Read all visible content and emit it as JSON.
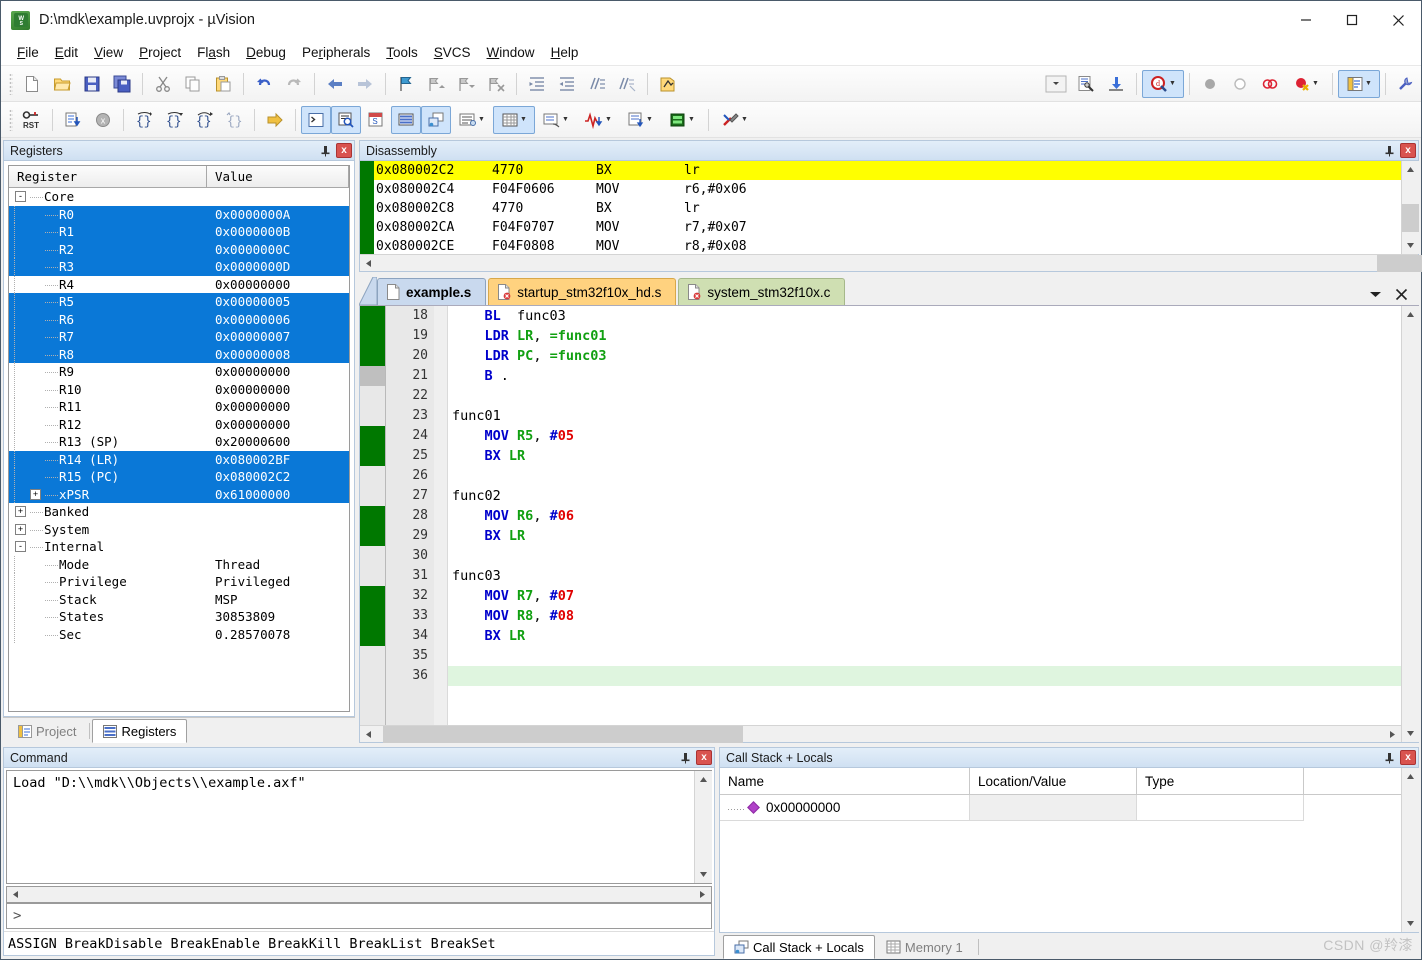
{
  "window": {
    "title": "D:\\mdk\\example.uvprojx - µVision",
    "app_icon": "uvision-icon",
    "minimize": "—",
    "maximize": "□",
    "close": "✕"
  },
  "menubar": {
    "items": [
      {
        "label": "File",
        "accel": "F"
      },
      {
        "label": "Edit",
        "accel": "E"
      },
      {
        "label": "View",
        "accel": "V"
      },
      {
        "label": "Project",
        "accel": "P"
      },
      {
        "label": "Flash",
        "accel": "a"
      },
      {
        "label": "Debug",
        "accel": "D"
      },
      {
        "label": "Peripherals",
        "accel": "r"
      },
      {
        "label": "Tools",
        "accel": "T"
      },
      {
        "label": "SVCS",
        "accel": "S"
      },
      {
        "label": "Window",
        "accel": "W"
      },
      {
        "label": "Help",
        "accel": "H"
      }
    ]
  },
  "toolbar_main": {
    "buttons": [
      {
        "name": "new-file-icon",
        "tip": "New"
      },
      {
        "name": "open-file-icon",
        "tip": "Open"
      },
      {
        "name": "save-icon",
        "tip": "Save"
      },
      {
        "name": "save-all-icon",
        "tip": "Save All"
      },
      {
        "name": "cut-icon",
        "tip": "Cut"
      },
      {
        "name": "copy-icon",
        "tip": "Copy"
      },
      {
        "name": "paste-icon",
        "tip": "Paste"
      },
      {
        "name": "undo-icon",
        "tip": "Undo"
      },
      {
        "name": "redo-icon",
        "tip": "Redo"
      },
      {
        "name": "navigate-back-icon",
        "tip": "Back"
      },
      {
        "name": "navigate-forward-icon",
        "tip": "Forward"
      },
      {
        "name": "bookmark-toggle-icon",
        "tip": "Insert/Remove Bookmark"
      },
      {
        "name": "bookmark-prev-icon",
        "tip": "Previous Bookmark"
      },
      {
        "name": "bookmark-next-icon",
        "tip": "Next Bookmark"
      },
      {
        "name": "bookmark-clear-icon",
        "tip": "Clear All Bookmarks"
      },
      {
        "name": "indent-icon",
        "tip": "Indent"
      },
      {
        "name": "outdent-icon",
        "tip": "Outdent"
      },
      {
        "name": "comment-icon",
        "tip": "Comment"
      },
      {
        "name": "uncomment-icon",
        "tip": "Uncomment"
      },
      {
        "name": "build-icon",
        "tip": "Build"
      }
    ],
    "right_buttons": [
      {
        "name": "combo-dropdown-icon",
        "tip": "Target selector"
      },
      {
        "name": "configure-target-icon",
        "tip": "Options for Target"
      },
      {
        "name": "download-icon",
        "tip": "Download"
      },
      {
        "name": "start-stop-debug-icon",
        "tip": "Start/Stop Debug Session",
        "active": true
      },
      {
        "name": "breakpoint-disabled-icon",
        "tip": "Insert/Remove Breakpoint"
      },
      {
        "name": "breakpoint-enable-icon",
        "tip": "Enable/Disable Breakpoint"
      },
      {
        "name": "breakpoint-disable-all-icon",
        "tip": "Disable All Breakpoints"
      },
      {
        "name": "breakpoint-kill-all-icon",
        "tip": "Kill All Breakpoints"
      },
      {
        "name": "project-window-icon",
        "tip": "Project Window",
        "active": true
      },
      {
        "name": "configure-icon",
        "tip": "Configure"
      }
    ]
  },
  "toolbar_debug": {
    "buttons": [
      {
        "name": "reset-cpu-icon",
        "tip": "Reset CPU"
      },
      {
        "name": "run-icon",
        "tip": "Run"
      },
      {
        "name": "stop-icon",
        "tip": "Stop"
      },
      {
        "name": "step-into-icon",
        "tip": "Step"
      },
      {
        "name": "step-over-icon",
        "tip": "Step Over"
      },
      {
        "name": "step-out-icon",
        "tip": "Step Out"
      },
      {
        "name": "run-to-cursor-icon",
        "tip": "Run to Cursor Line"
      },
      {
        "name": "show-next-statement-icon",
        "tip": "Show Next Statement"
      },
      {
        "name": "command-window-icon",
        "tip": "Command Window",
        "active": true
      },
      {
        "name": "disassembly-window-icon",
        "tip": "Disassembly Window",
        "active": true
      },
      {
        "name": "symbols-window-icon",
        "tip": "Symbols Window"
      },
      {
        "name": "registers-window-icon",
        "tip": "Registers Window",
        "active": true
      },
      {
        "name": "call-stack-window-icon",
        "tip": "Call Stack Window",
        "active": true
      },
      {
        "name": "watch-windows-icon",
        "tip": "Watch Windows"
      },
      {
        "name": "memory-windows-icon",
        "tip": "Memory Windows",
        "active": true
      },
      {
        "name": "serial-windows-icon",
        "tip": "Serial Windows"
      },
      {
        "name": "analysis-windows-icon",
        "tip": "Analysis Windows"
      },
      {
        "name": "trace-windows-icon",
        "tip": "Trace Windows"
      },
      {
        "name": "system-viewer-icon",
        "tip": "System Viewer"
      },
      {
        "name": "toolbox-icon",
        "tip": "Toolbox"
      }
    ]
  },
  "registers_panel": {
    "title": "Registers",
    "pin_icon": "pin-icon",
    "close_icon": "close-icon",
    "columns": [
      "Register",
      "Value"
    ],
    "rows": [
      {
        "label": "Core",
        "value": "",
        "depth": 0,
        "expander": "-",
        "selected": false
      },
      {
        "label": "R0",
        "value": "0x0000000A",
        "depth": 2,
        "expander": "",
        "selected": true
      },
      {
        "label": "R1",
        "value": "0x0000000B",
        "depth": 2,
        "expander": "",
        "selected": true
      },
      {
        "label": "R2",
        "value": "0x0000000C",
        "depth": 2,
        "expander": "",
        "selected": true
      },
      {
        "label": "R3",
        "value": "0x0000000D",
        "depth": 2,
        "expander": "",
        "selected": true
      },
      {
        "label": "R4",
        "value": "0x00000000",
        "depth": 2,
        "expander": "",
        "selected": false
      },
      {
        "label": "R5",
        "value": "0x00000005",
        "depth": 2,
        "expander": "",
        "selected": true
      },
      {
        "label": "R6",
        "value": "0x00000006",
        "depth": 2,
        "expander": "",
        "selected": true
      },
      {
        "label": "R7",
        "value": "0x00000007",
        "depth": 2,
        "expander": "",
        "selected": true
      },
      {
        "label": "R8",
        "value": "0x00000008",
        "depth": 2,
        "expander": "",
        "selected": true
      },
      {
        "label": "R9",
        "value": "0x00000000",
        "depth": 2,
        "expander": "",
        "selected": false
      },
      {
        "label": "R10",
        "value": "0x00000000",
        "depth": 2,
        "expander": "",
        "selected": false
      },
      {
        "label": "R11",
        "value": "0x00000000",
        "depth": 2,
        "expander": "",
        "selected": false
      },
      {
        "label": "R12",
        "value": "0x00000000",
        "depth": 2,
        "expander": "",
        "selected": false
      },
      {
        "label": "R13 (SP)",
        "value": "0x20000600",
        "depth": 2,
        "expander": "",
        "selected": false
      },
      {
        "label": "R14 (LR)",
        "value": "0x080002BF",
        "depth": 2,
        "expander": "",
        "selected": true
      },
      {
        "label": "R15 (PC)",
        "value": "0x080002C2",
        "depth": 2,
        "expander": "",
        "selected": true
      },
      {
        "label": "xPSR",
        "value": "0x61000000",
        "depth": 1,
        "expander": "+",
        "selected": true
      },
      {
        "label": "Banked",
        "value": "",
        "depth": 0,
        "expander": "+",
        "selected": false
      },
      {
        "label": "System",
        "value": "",
        "depth": 0,
        "expander": "+",
        "selected": false
      },
      {
        "label": "Internal",
        "value": "",
        "depth": 0,
        "expander": "-",
        "selected": false
      },
      {
        "label": "Mode",
        "value": "Thread",
        "depth": 2,
        "expander": "",
        "selected": false
      },
      {
        "label": "Privilege",
        "value": "Privileged",
        "depth": 2,
        "expander": "",
        "selected": false
      },
      {
        "label": "Stack",
        "value": "MSP",
        "depth": 2,
        "expander": "",
        "selected": false
      },
      {
        "label": "States",
        "value": "30853809",
        "depth": 2,
        "expander": "",
        "selected": false
      },
      {
        "label": "Sec",
        "value": "0.28570078",
        "depth": 2,
        "expander": "",
        "selected": false
      }
    ]
  },
  "left_dock_tabs": [
    {
      "label": "Project",
      "icon": "project-icon",
      "active": false
    },
    {
      "label": "Registers",
      "icon": "registers-icon",
      "active": true
    }
  ],
  "disassembly": {
    "title": "Disassembly",
    "pin_icon": "pin-icon",
    "close_icon": "close-icon",
    "current_marker": "yellow-arrow-icon",
    "lines": [
      {
        "address": "0x080002C2",
        "opcode": "4770",
        "mnemonic": "BX",
        "operands": "lr",
        "current": true
      },
      {
        "address": "0x080002C4",
        "opcode": "F04F0606",
        "mnemonic": "MOV",
        "operands": "r6,#0x06",
        "current": false
      },
      {
        "address": "0x080002C8",
        "opcode": "4770",
        "mnemonic": "BX",
        "operands": "lr",
        "current": false
      },
      {
        "address": "0x080002CA",
        "opcode": "F04F0707",
        "mnemonic": "MOV",
        "operands": "r7,#0x07",
        "current": false
      },
      {
        "address": "0x080002CE",
        "opcode": "F04F0808",
        "mnemonic": "MOV",
        "operands": "r8,#0x08",
        "current": false
      }
    ]
  },
  "editor": {
    "tabs": [
      {
        "label": "example.s",
        "icon": "text-file-icon",
        "active": true,
        "style": "active"
      },
      {
        "label": "startup_stm32f10x_hd.s",
        "icon": "asm-file-icon",
        "active": false,
        "style": "orange"
      },
      {
        "label": "system_stm32f10x.c",
        "icon": "c-file-icon",
        "active": false,
        "style": "green"
      }
    ],
    "tab_dropdown_icon": "chevron-down-icon",
    "tab_close_icon": "close-icon",
    "lines": [
      {
        "no": "18",
        "marker": "green",
        "highlight": false,
        "tokens": [
          {
            "t": "plain",
            "v": "    "
          },
          {
            "t": "mn",
            "v": "BL"
          },
          {
            "t": "plain",
            "v": "  func03"
          }
        ]
      },
      {
        "no": "19",
        "marker": "green",
        "highlight": false,
        "tokens": [
          {
            "t": "plain",
            "v": "    "
          },
          {
            "t": "mn",
            "v": "LDR"
          },
          {
            "t": "plain",
            "v": " "
          },
          {
            "t": "reg",
            "v": "LR"
          },
          {
            "t": "plain",
            "v": ", "
          },
          {
            "t": "reg",
            "v": "=func01"
          }
        ]
      },
      {
        "no": "20",
        "marker": "green",
        "highlight": false,
        "tokens": [
          {
            "t": "plain",
            "v": "    "
          },
          {
            "t": "mn",
            "v": "LDR"
          },
          {
            "t": "plain",
            "v": " "
          },
          {
            "t": "reg",
            "v": "PC"
          },
          {
            "t": "plain",
            "v": ", "
          },
          {
            "t": "reg",
            "v": "=func03"
          }
        ]
      },
      {
        "no": "21",
        "marker": "gray",
        "highlight": false,
        "tokens": [
          {
            "t": "plain",
            "v": "    "
          },
          {
            "t": "mn",
            "v": "B"
          },
          {
            "t": "plain",
            "v": " ."
          }
        ]
      },
      {
        "no": "22",
        "marker": "none",
        "highlight": false,
        "tokens": []
      },
      {
        "no": "23",
        "marker": "none",
        "highlight": false,
        "tokens": [
          {
            "t": "plain",
            "v": "func01"
          }
        ]
      },
      {
        "no": "24",
        "marker": "green",
        "highlight": false,
        "tokens": [
          {
            "t": "plain",
            "v": "    "
          },
          {
            "t": "mn",
            "v": "MOV"
          },
          {
            "t": "plain",
            "v": " "
          },
          {
            "t": "reg",
            "v": "R5"
          },
          {
            "t": "plain",
            "v": ", "
          },
          {
            "t": "mn",
            "v": "#"
          },
          {
            "t": "num",
            "v": "05"
          }
        ]
      },
      {
        "no": "25",
        "marker": "green",
        "highlight": false,
        "tokens": [
          {
            "t": "plain",
            "v": "    "
          },
          {
            "t": "mn",
            "v": "BX"
          },
          {
            "t": "plain",
            "v": " "
          },
          {
            "t": "reg",
            "v": "LR"
          }
        ]
      },
      {
        "no": "26",
        "marker": "none",
        "highlight": false,
        "tokens": []
      },
      {
        "no": "27",
        "marker": "none",
        "highlight": false,
        "tokens": [
          {
            "t": "plain",
            "v": "func02"
          }
        ]
      },
      {
        "no": "28",
        "marker": "green",
        "highlight": false,
        "tokens": [
          {
            "t": "plain",
            "v": "    "
          },
          {
            "t": "mn",
            "v": "MOV"
          },
          {
            "t": "plain",
            "v": " "
          },
          {
            "t": "reg",
            "v": "R6"
          },
          {
            "t": "plain",
            "v": ", "
          },
          {
            "t": "mn",
            "v": "#"
          },
          {
            "t": "num",
            "v": "06"
          }
        ]
      },
      {
        "no": "29",
        "marker": "green",
        "highlight": false,
        "tokens": [
          {
            "t": "plain",
            "v": "    "
          },
          {
            "t": "mn",
            "v": "BX"
          },
          {
            "t": "plain",
            "v": " "
          },
          {
            "t": "reg",
            "v": "LR"
          }
        ]
      },
      {
        "no": "30",
        "marker": "none",
        "highlight": false,
        "tokens": []
      },
      {
        "no": "31",
        "marker": "none",
        "highlight": false,
        "tokens": [
          {
            "t": "plain",
            "v": "func03"
          }
        ]
      },
      {
        "no": "32",
        "marker": "green",
        "highlight": false,
        "tokens": [
          {
            "t": "plain",
            "v": "    "
          },
          {
            "t": "mn",
            "v": "MOV"
          },
          {
            "t": "plain",
            "v": " "
          },
          {
            "t": "reg",
            "v": "R7"
          },
          {
            "t": "plain",
            "v": ", "
          },
          {
            "t": "mn",
            "v": "#"
          },
          {
            "t": "num",
            "v": "07"
          }
        ]
      },
      {
        "no": "33",
        "marker": "green",
        "highlight": false,
        "tokens": [
          {
            "t": "plain",
            "v": "    "
          },
          {
            "t": "mn",
            "v": "MOV"
          },
          {
            "t": "plain",
            "v": " "
          },
          {
            "t": "reg",
            "v": "R8"
          },
          {
            "t": "plain",
            "v": ", "
          },
          {
            "t": "mn",
            "v": "#"
          },
          {
            "t": "num",
            "v": "08"
          }
        ]
      },
      {
        "no": "34",
        "marker": "green",
        "highlight": false,
        "tokens": [
          {
            "t": "plain",
            "v": "    "
          },
          {
            "t": "mn",
            "v": "BX"
          },
          {
            "t": "plain",
            "v": " "
          },
          {
            "t": "reg",
            "v": "LR"
          }
        ]
      },
      {
        "no": "35",
        "marker": "none",
        "highlight": false,
        "tokens": []
      },
      {
        "no": "36",
        "marker": "none",
        "highlight": true,
        "tokens": []
      }
    ]
  },
  "command_panel": {
    "title": "Command",
    "pin_icon": "pin-icon",
    "close_icon": "close-icon",
    "output": "Load \"D:\\\\mdk\\\\Objects\\\\example.axf\"",
    "prompt": ">",
    "input_value": "",
    "keyword_hints": "ASSIGN BreakDisable BreakEnable BreakKill BreakList BreakSet"
  },
  "call_stack_panel": {
    "title": "Call Stack + Locals",
    "pin_icon": "pin-icon",
    "close_icon": "close-icon",
    "columns": [
      "Name",
      "Location/Value",
      "Type",
      ""
    ],
    "rows": [
      {
        "name": "0x00000000",
        "location": "",
        "type": "",
        "icon": "diamond-icon"
      }
    ]
  },
  "bottom_tabs": [
    {
      "label": "Call Stack + Locals",
      "icon": "call-stack-icon",
      "active": true
    },
    {
      "label": "Memory 1",
      "icon": "memory-icon",
      "active": false
    }
  ],
  "watermark": "CSDN @羚漆",
  "colors": {
    "selection_blue": "#0a78d7",
    "current_line_yellow": "#ffff00",
    "breakpoint_green": "#007800",
    "highlight_line_green": "#dff5df",
    "panel_header": "#cfe0f2",
    "tab_active": "#c9d9ee",
    "tab_orange": "#ffd27f",
    "tab_green": "#cfdfb2"
  }
}
